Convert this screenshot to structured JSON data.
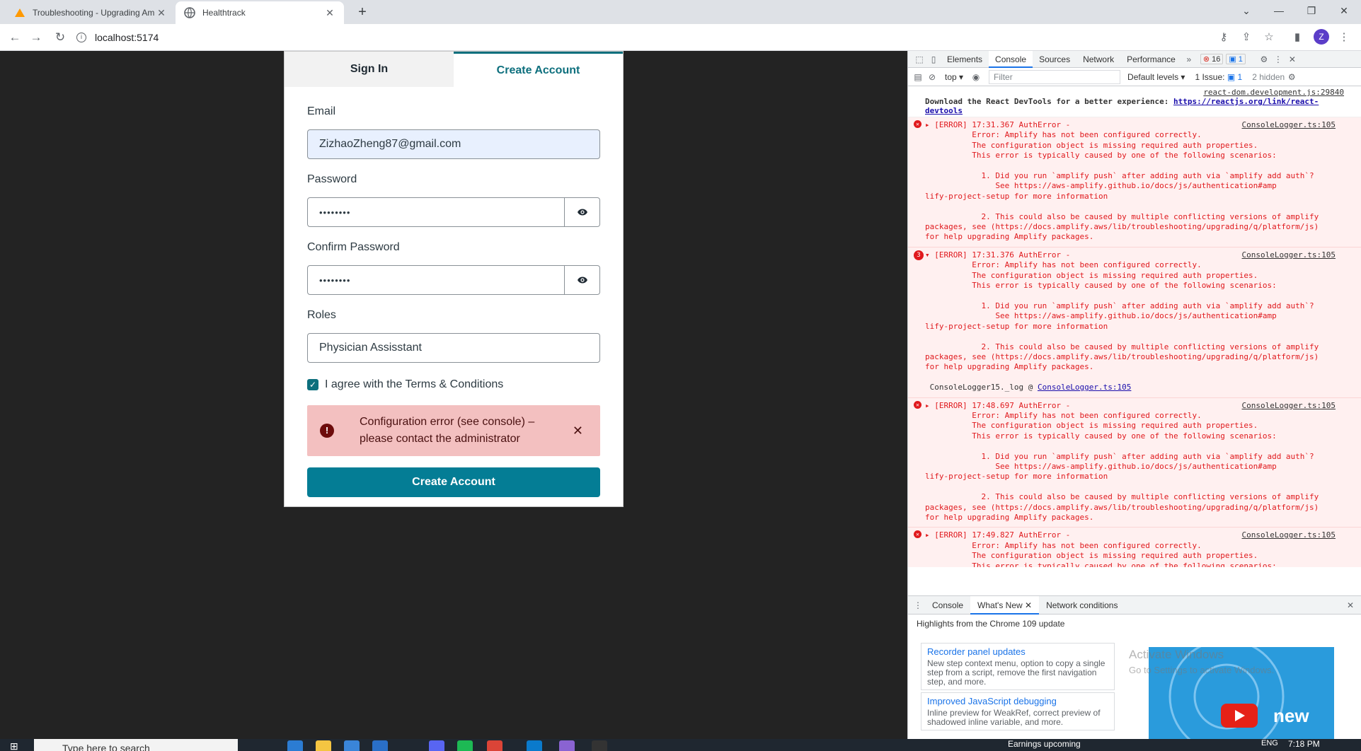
{
  "browser": {
    "tabs": [
      {
        "title": "Troubleshooting - Upgrading Am",
        "active": false,
        "icon": "amplify-favicon"
      },
      {
        "title": "Healthtrack",
        "active": true,
        "icon": "globe-favicon"
      }
    ],
    "url": "localhost:5174"
  },
  "auth": {
    "tab_signin": "Sign In",
    "tab_create": "Create Account",
    "email_label": "Email",
    "email_value": "ZizhaoZheng87@gmail.com",
    "password_label": "Password",
    "password_value": "••••••••",
    "confirm_label": "Confirm Password",
    "confirm_value": "••••••••",
    "roles_label": "Roles",
    "roles_value": "Physician Assisstant",
    "terms_label": "I agree with the Terms & Conditions",
    "terms_checked": true,
    "alert_line1": "Configuration error (see console) –",
    "alert_line2": "please contact the administrator",
    "submit_label": "Create Account",
    "accent": "#047d95"
  },
  "devtools": {
    "tabs": [
      "Elements",
      "Console",
      "Sources",
      "Network",
      "Performance"
    ],
    "active_tab": "Console",
    "error_count": "16",
    "message_count": "1",
    "context": "top",
    "filter_placeholder": "Filter",
    "levels": "Default levels",
    "issues": "1 Issue:",
    "issues_count": "1",
    "hidden": "2 hidden",
    "react_source": "react-dom.development.js:29840",
    "react_msg": "Download the React DevTools for a better experience:",
    "react_link": "https://reactjs.org/link/react-devtools",
    "errors": [
      {
        "time": "17:31.367",
        "expanded": false,
        "source": "ConsoleLogger.ts:105",
        "count": ""
      },
      {
        "time": "17:31.376",
        "expanded": true,
        "source": "ConsoleLogger.ts:105",
        "count": "3"
      },
      {
        "time": "17:48.697",
        "expanded": false,
        "source": "ConsoleLogger.ts:105",
        "count": ""
      },
      {
        "time": "17:49.827",
        "expanded": false,
        "source": "ConsoleLogger.ts:105",
        "count": ""
      }
    ],
    "error_head": "[ERROR] {time} AuthError -",
    "error_l1": "Error: Amplify has not been configured correctly.",
    "error_l2": "The configuration object is missing required auth properties.",
    "error_l3": "This error is typically caused by one of the following scenarios:",
    "error_l4": "1. Did you run `amplify push` after adding auth via `amplify add auth`?",
    "error_l5": "See https://aws-amplify.github.io/docs/js/authentication#amplify-project-setup for more information",
    "error_l6": "2. This could also be caused by multiple conflicting versions of amplify",
    "error_l7": "packages, see (https://docs.amplify.aws/lib/troubleshooting/upgrading/q/platform/js)",
    "error_l8": "for help upgrading Amplify packages.",
    "stack_line": "ConsoleLogger15._log @",
    "stack_link": "ConsoleLogger.ts:105",
    "drawer_tabs": [
      "Console",
      "What's New",
      "Network conditions"
    ],
    "drawer_active": "What's New",
    "whatsnew_title": "Highlights from the Chrome 109 update",
    "cards": [
      {
        "title": "Recorder panel updates",
        "desc": "New step context menu, option to copy a single step from a script, remove the first navigation step, and more."
      },
      {
        "title": "Improved JavaScript debugging",
        "desc": "Inline preview for WeakRef, correct preview of shadowed inline variable, and more."
      }
    ],
    "video_text": "new",
    "watermark_line1": "Activate Windows",
    "watermark_line2": "Go to Settings to activate Windows."
  },
  "taskbar": {
    "search_placeholder": "Type here to search",
    "news": "Earnings upcoming",
    "lang": "ENG",
    "time": "7:18 PM"
  }
}
